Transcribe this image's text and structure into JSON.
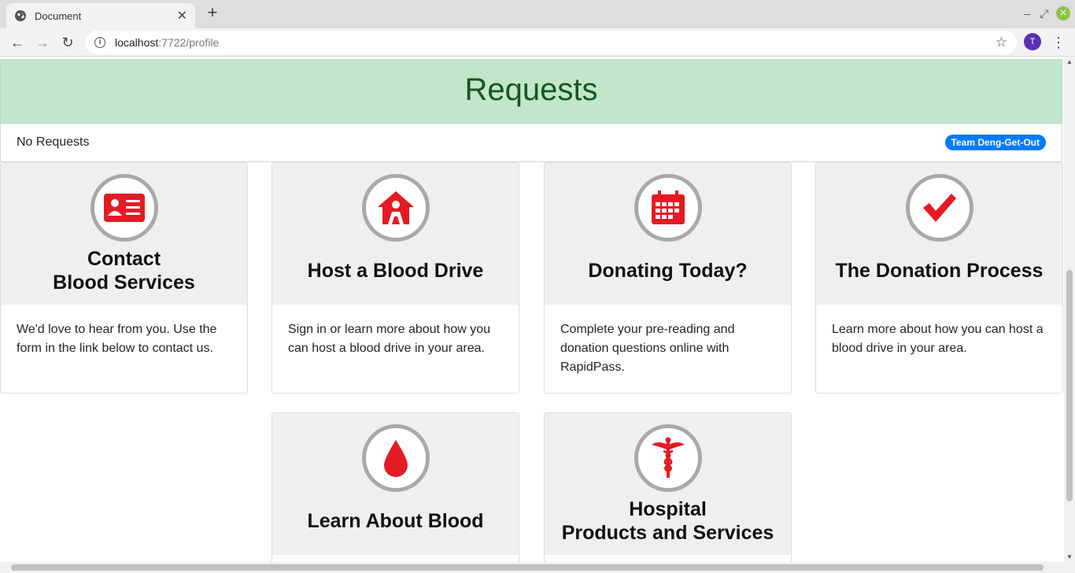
{
  "browser": {
    "tab_title": "Document",
    "tab_close": "✕",
    "new_tab": "+",
    "url_host": "localhost",
    "url_rest": ":7722/profile",
    "profile_initial": "T"
  },
  "requests": {
    "heading": "Requests",
    "empty_text": "No Requests",
    "team_badge": "Team Deng-Get-Out"
  },
  "cards": [
    {
      "title_line1": "Contact",
      "title_line2": "Blood Services",
      "icon": "id-card-icon",
      "body": "We'd love to hear from you. Use the form in the link below to contact us."
    },
    {
      "title_line1": "Host a Blood Drive",
      "title_line2": "",
      "icon": "house-person-icon",
      "body": "Sign in or learn more about how you can host a blood drive in your area."
    },
    {
      "title_line1": "Donating Today?",
      "title_line2": "",
      "icon": "calendar-icon",
      "body": "Complete your pre-reading and donation questions online with RapidPass."
    },
    {
      "title_line1": "The Donation Process",
      "title_line2": "",
      "icon": "checkmark-icon",
      "body": "Learn more about how you can host a blood drive in your area."
    },
    {
      "title_line1": "Learn About Blood",
      "title_line2": "",
      "icon": "blood-drop-icon",
      "body": ""
    },
    {
      "title_line1": "Hospital",
      "title_line2": "Products and Services",
      "icon": "caduceus-icon",
      "body": ""
    }
  ],
  "colors": {
    "brand_red": "#e31b23",
    "header_green_bg": "#c3e6cb",
    "header_green_text": "#155724",
    "badge_blue": "#007bff"
  }
}
